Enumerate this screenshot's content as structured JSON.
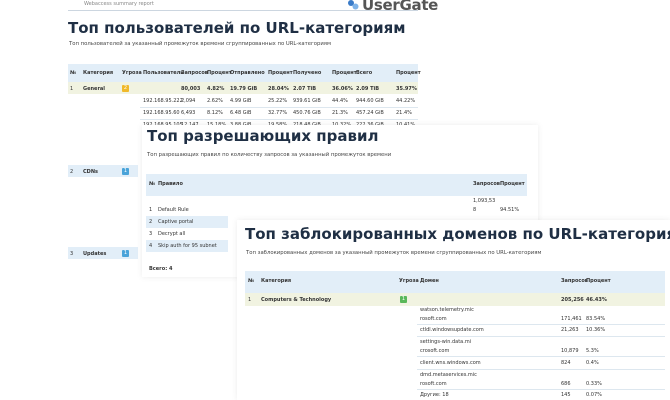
{
  "header": {
    "report_name": "Webaccess summary report",
    "logo_text": "UserGate"
  },
  "colors": {
    "accent": "#1f2f44",
    "band": "#e2eef8",
    "badge_warning": "#f0b92a",
    "badge_info": "#4aa3d9",
    "badge_ok": "#5ab85a"
  },
  "users": {
    "title": "Топ пользователей по URL-категориям",
    "subtitle": "Топ пользователей за указанный промежуток времени сгруппированных по URL-категориям",
    "columns": [
      "№",
      "Категория",
      "Угроза",
      "Пользователь",
      "Запросов",
      "Процент",
      "Отправлено",
      "Процент",
      "Получено",
      "Процент",
      "Всего",
      "Процент"
    ],
    "rows": [
      {
        "num": "1",
        "category": "General",
        "threat": "2",
        "requests": "80,003",
        "pct1": "4.82%",
        "sent": "19.79 GiB",
        "pct2": "28.04%",
        "recv": "2.07 TiB",
        "pct3": "36.06%",
        "total": "2.09 TiB",
        "pct4": "35.97%"
      },
      {
        "user": "192.168.95.222",
        "requests": "2,094",
        "pct1": "2.62%",
        "sent": "4.99 GiB",
        "pct2": "25.22%",
        "recv": "939.61 GiB",
        "pct3": "44.4%",
        "total": "944.60 GiB",
        "pct4": "44.22%"
      },
      {
        "user": "192.168.95.60",
        "requests": "6,493",
        "pct1": "8.12%",
        "sent": "6.48 GiB",
        "pct2": "32.77%",
        "recv": "450.76 GiB",
        "pct3": "21.3%",
        "total": "457.24 GiB",
        "pct4": "21.4%"
      },
      {
        "user": "192.168.95.105",
        "requests": "12,147",
        "pct1": "15.18%",
        "sent": "3.88 GiB",
        "pct2": "19.58%",
        "recv": "218.48 GiB",
        "pct3": "10.32%",
        "total": "222.36 GiB",
        "pct4": "10.41%"
      }
    ],
    "more_rows": [
      {
        "num": "2",
        "category": "CDNs",
        "threat": "1"
      },
      {
        "num": "3",
        "category": "Updates",
        "threat": "1"
      }
    ]
  },
  "rules": {
    "title": "Топ разрешающих правил",
    "subtitle": "Топ разрешающих правил по количеству запросов за указанный промежуток времени",
    "columns": [
      "№",
      "Правило",
      "Запросов",
      "Процент"
    ],
    "header_value": "1,093,53",
    "rows": [
      {
        "num": "1",
        "rule": "Default Rule",
        "requests": "8",
        "pct": "94.51%"
      },
      {
        "num": "2",
        "rule": "Captive portal"
      },
      {
        "num": "3",
        "rule": "Decrypt all"
      },
      {
        "num": "4",
        "rule": "Skip auth for 95 subnet"
      }
    ],
    "total": "Всего: 4"
  },
  "domains": {
    "title": "Топ заблокированных доменов по URL-категориям",
    "subtitle": "Топ заблокированных доменов за указанный промежуток времени сгруппированных по URL-категориям",
    "columns": [
      "№",
      "Категория",
      "Угроза",
      "Домен",
      "Запросов",
      "Процент"
    ],
    "group": {
      "num": "1",
      "category": "Computers & Technology",
      "threat": "1",
      "requests": "205,256",
      "pct": "46.43%"
    },
    "rows": [
      {
        "domain_l1": "watson.telemetry.mic",
        "domain_l2": "rosoft.com",
        "requests": "171,461",
        "pct": "83.54%"
      },
      {
        "domain_l1": "ctldl.windowsupdate.com",
        "domain_l2": "",
        "requests": "21,263",
        "pct": "10.36%"
      },
      {
        "domain_l1": "settings-win.data.mi",
        "domain_l2": "crosoft.com",
        "requests": "10,879",
        "pct": "5.3%"
      },
      {
        "domain_l1": "client.wns.windows.com",
        "domain_l2": "",
        "requests": "824",
        "pct": "0.4%"
      },
      {
        "domain_l1": "dmd.metaservices.mic",
        "domain_l2": "rosoft.com",
        "requests": "686",
        "pct": "0.33%"
      }
    ],
    "other": {
      "label": "Другие: 18",
      "requests": "145",
      "pct": "0.07%"
    }
  }
}
